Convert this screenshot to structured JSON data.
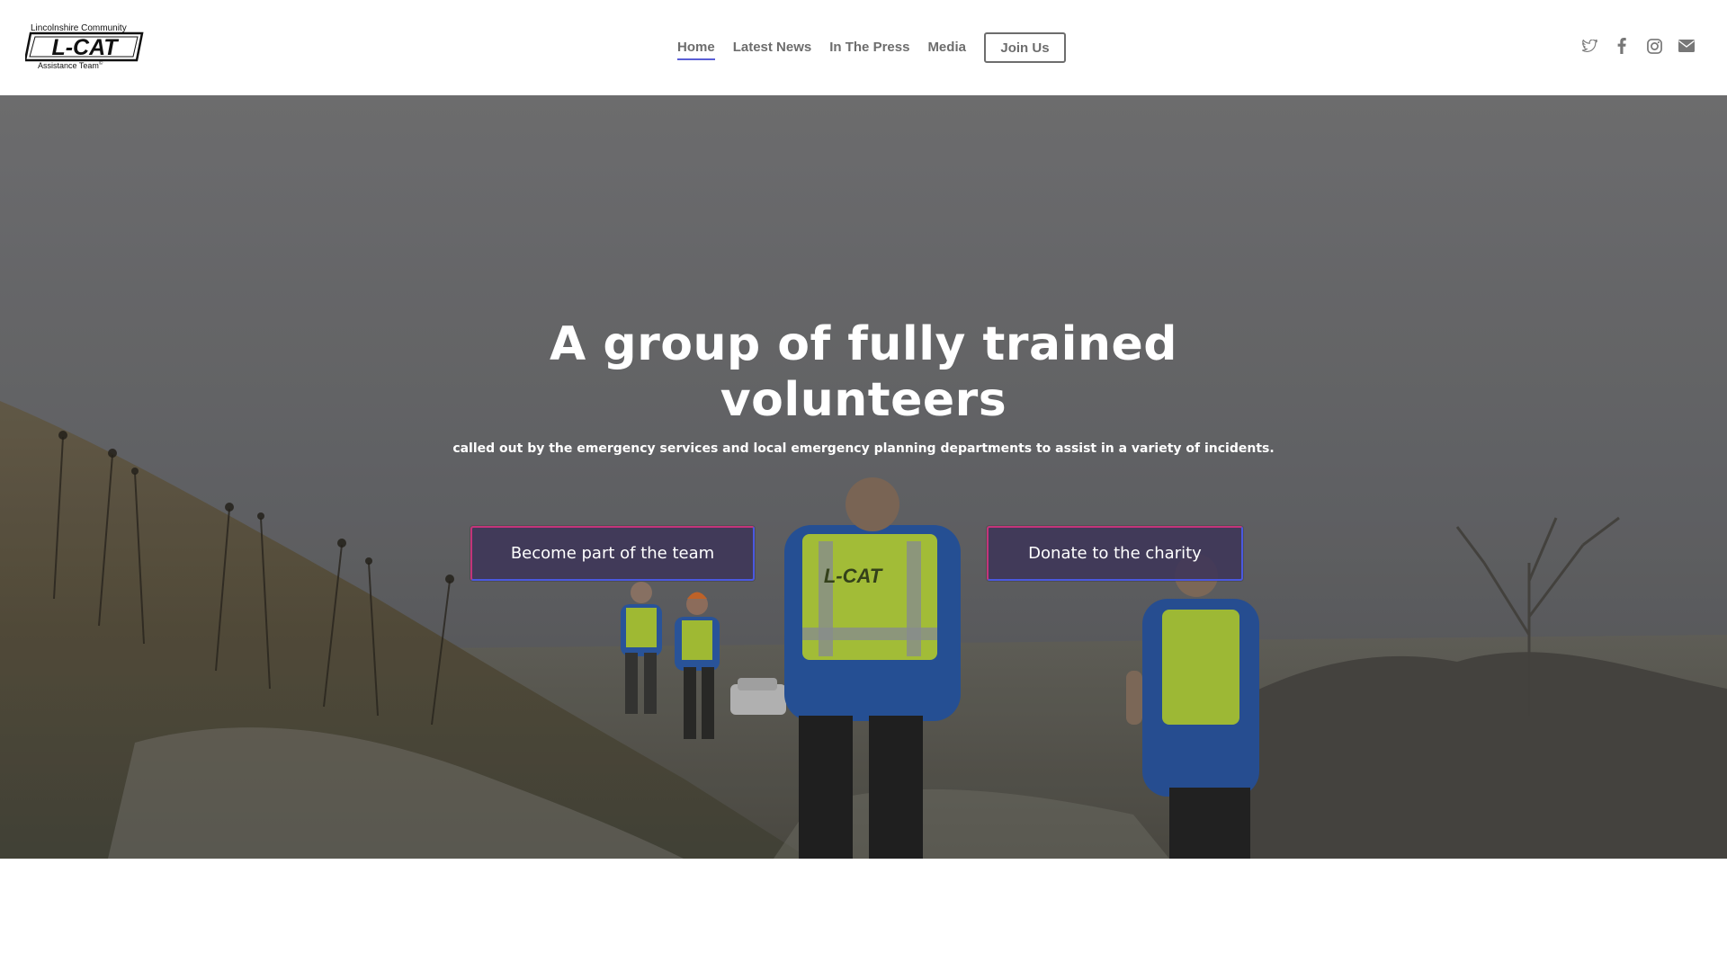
{
  "logo": {
    "top_text": "Lincolnshire Community",
    "mark_text": "L-CAT",
    "bottom_text": "Assistance Team",
    "mark": "©"
  },
  "nav": {
    "items": [
      {
        "label": "Home",
        "active": true
      },
      {
        "label": "Latest News",
        "active": false
      },
      {
        "label": "In The Press",
        "active": false
      },
      {
        "label": "Media",
        "active": false
      }
    ],
    "join_label": "Join Us"
  },
  "social": {
    "icons": [
      "twitter-icon",
      "facebook-icon",
      "instagram-icon",
      "email-icon"
    ],
    "color": "#777777"
  },
  "hero": {
    "title": "A group of fully trained volunteers",
    "subtitle": "called out by the emergency services and local emergency planning departments to assist in a variety of incidents.",
    "cta_team": "Become part of the team",
    "cta_donate": "Donate to the charity",
    "vest_text": "L-CAT"
  },
  "colors": {
    "accent": "#5a5fd6",
    "cta_border_pink": "#c3347a",
    "cta_border_blue": "#4a58e0",
    "cta_fill": "#3c3458"
  }
}
